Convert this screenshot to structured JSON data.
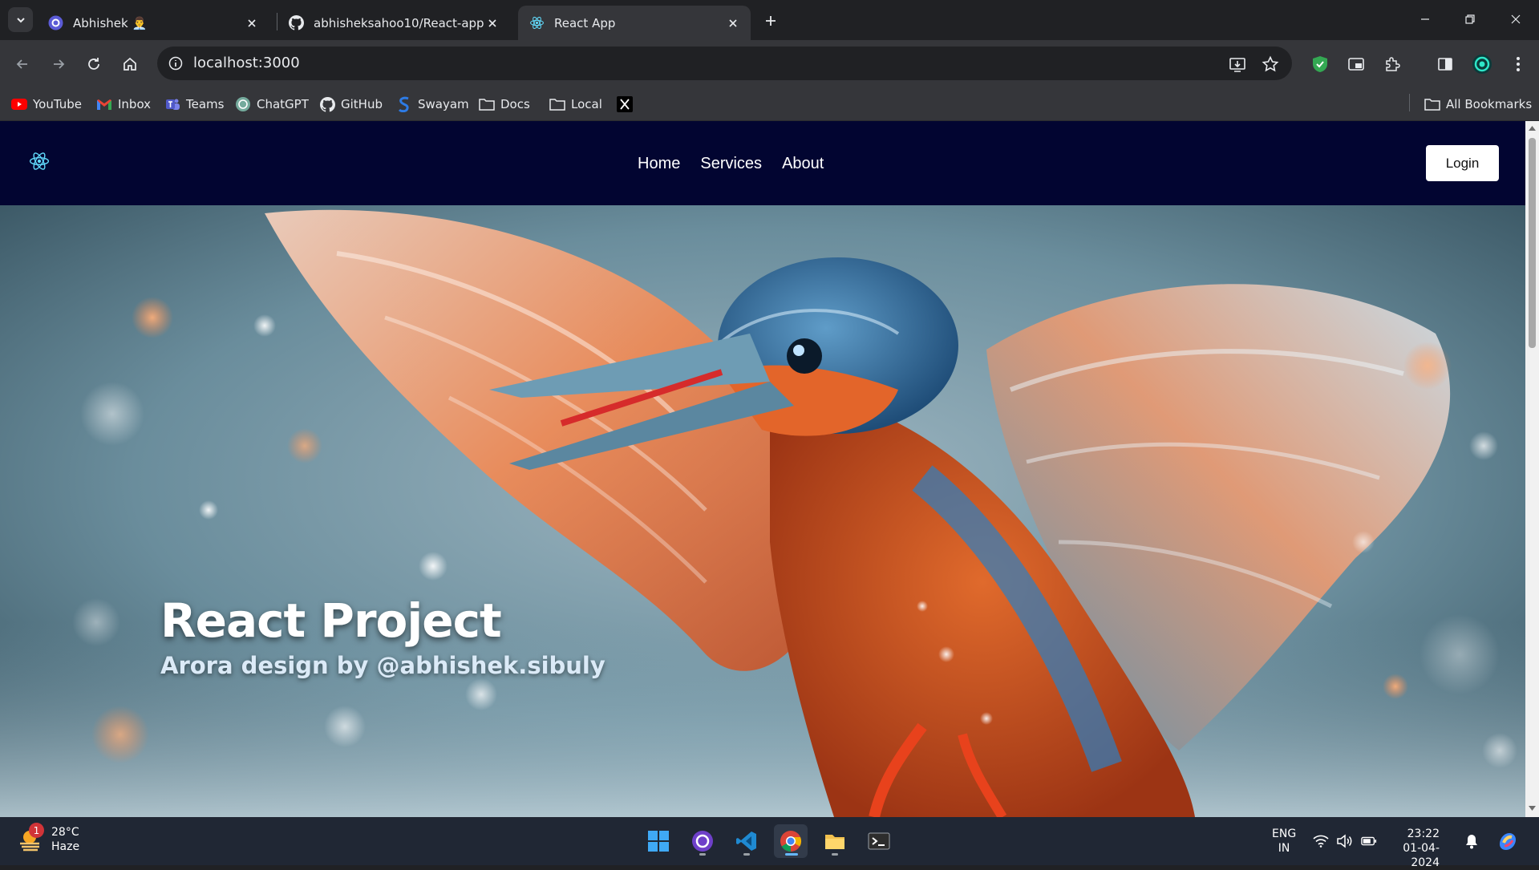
{
  "browser": {
    "tabs": [
      {
        "title": "Abhishek 👨‍💼",
        "active": false
      },
      {
        "title": "abhisheksahoo10/React-app",
        "active": false
      },
      {
        "title": "React App",
        "active": true
      }
    ],
    "url": "localhost:3000",
    "bookmarks": [
      "YouTube",
      "Inbox",
      "Teams",
      "ChatGPT",
      "GitHub",
      "Swayam",
      "Docs",
      "Local",
      ""
    ],
    "all_bookmarks_label": "All Bookmarks"
  },
  "page": {
    "nav": {
      "home": "Home",
      "services": "Services",
      "about": "About",
      "login": "Login"
    },
    "hero": {
      "title": "React Project",
      "subtitle": "Arora design by @abhishek.sibuly"
    }
  },
  "taskbar": {
    "weather": {
      "temp": "28°C",
      "condition": "Haze",
      "badge": "1"
    },
    "lang": {
      "line1": "ENG",
      "line2": "IN"
    },
    "clock": {
      "time": "23:22",
      "date": "01-04-2024"
    }
  },
  "colors": {
    "navbar": "#020531",
    "chrome_dark": "#202124",
    "chrome_toolbar": "#35363a",
    "taskbar": "#202734",
    "accent_blue": "#67b8ff"
  }
}
